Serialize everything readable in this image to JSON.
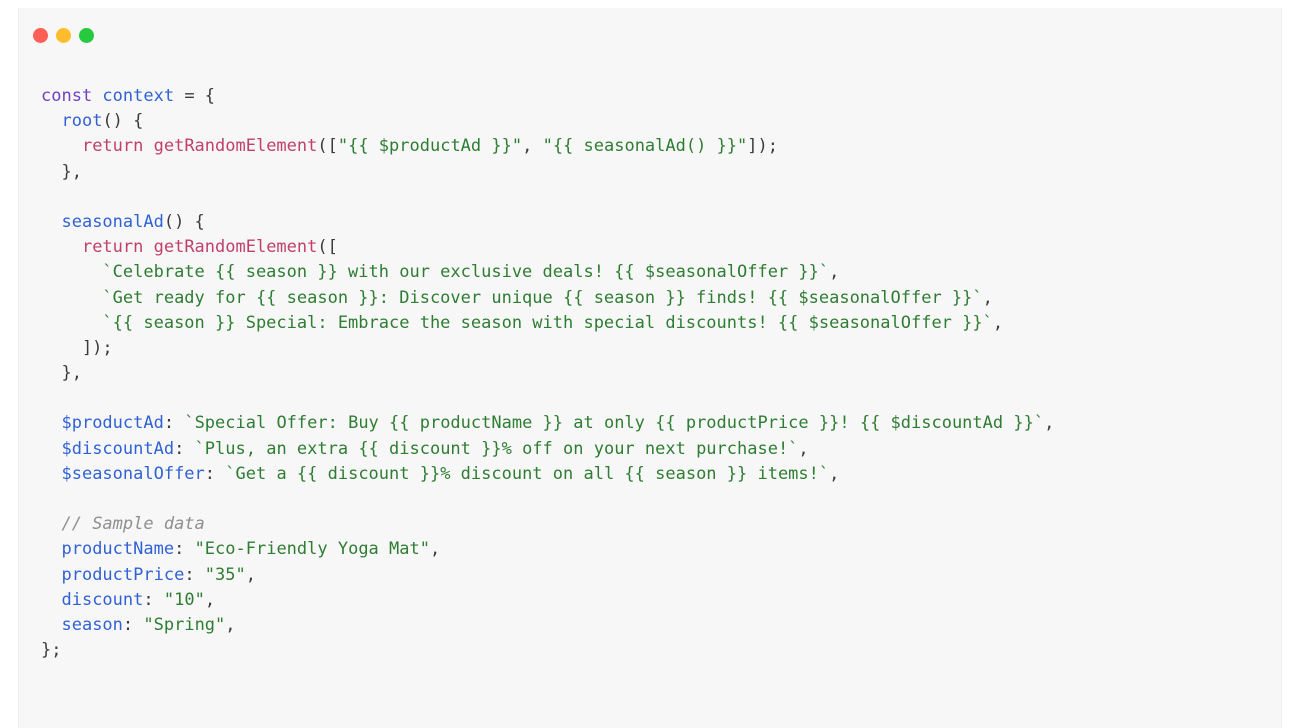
{
  "window": {
    "controls": {
      "close_color": "#ff5f56",
      "minimize_color": "#ffbd2e",
      "zoom_color": "#27c93f"
    }
  },
  "code": {
    "lines": [
      [
        {
          "t": "const ",
          "c": "kw"
        },
        {
          "t": "context",
          "c": "var"
        },
        {
          "t": " = {",
          "c": "pun"
        }
      ],
      [
        {
          "t": "  ",
          "c": "pun"
        },
        {
          "t": "root",
          "c": "prop"
        },
        {
          "t": "() {",
          "c": "pun"
        }
      ],
      [
        {
          "t": "    ",
          "c": "pun"
        },
        {
          "t": "return ",
          "c": "fn"
        },
        {
          "t": "getRandomElement",
          "c": "fn"
        },
        {
          "t": "([",
          "c": "pun"
        },
        {
          "t": "\"{{ $productAd }}\"",
          "c": "str"
        },
        {
          "t": ", ",
          "c": "pun"
        },
        {
          "t": "\"{{ seasonalAd() }}\"",
          "c": "str"
        },
        {
          "t": "]);",
          "c": "pun"
        }
      ],
      [
        {
          "t": "  },",
          "c": "pun"
        }
      ],
      [
        {
          "t": "",
          "c": "pun"
        }
      ],
      [
        {
          "t": "  ",
          "c": "pun"
        },
        {
          "t": "seasonalAd",
          "c": "prop"
        },
        {
          "t": "() {",
          "c": "pun"
        }
      ],
      [
        {
          "t": "    ",
          "c": "pun"
        },
        {
          "t": "return ",
          "c": "fn"
        },
        {
          "t": "getRandomElement",
          "c": "fn"
        },
        {
          "t": "([",
          "c": "pun"
        }
      ],
      [
        {
          "t": "      ",
          "c": "pun"
        },
        {
          "t": "`Celebrate {{ season }} with our exclusive deals! {{ $seasonalOffer }}`",
          "c": "str"
        },
        {
          "t": ",",
          "c": "pun"
        }
      ],
      [
        {
          "t": "      ",
          "c": "pun"
        },
        {
          "t": "`Get ready for {{ season }}: Discover unique {{ season }} finds! {{ $seasonalOffer }}`",
          "c": "str"
        },
        {
          "t": ",",
          "c": "pun"
        }
      ],
      [
        {
          "t": "      ",
          "c": "pun"
        },
        {
          "t": "`{{ season }} Special: Embrace the season with special discounts! {{ $seasonalOffer }}`",
          "c": "str"
        },
        {
          "t": ",",
          "c": "pun"
        }
      ],
      [
        {
          "t": "    ]);",
          "c": "pun"
        }
      ],
      [
        {
          "t": "  },",
          "c": "pun"
        }
      ],
      [
        {
          "t": "",
          "c": "pun"
        }
      ],
      [
        {
          "t": "  ",
          "c": "pun"
        },
        {
          "t": "$productAd",
          "c": "prop"
        },
        {
          "t": ": ",
          "c": "pun"
        },
        {
          "t": "`Special Offer: Buy {{ productName }} at only {{ productPrice }}! {{ $discountAd }}`",
          "c": "str"
        },
        {
          "t": ",",
          "c": "pun"
        }
      ],
      [
        {
          "t": "  ",
          "c": "pun"
        },
        {
          "t": "$discountAd",
          "c": "prop"
        },
        {
          "t": ": ",
          "c": "pun"
        },
        {
          "t": "`Plus, an extra {{ discount }}% off on your next purchase!`",
          "c": "str"
        },
        {
          "t": ",",
          "c": "pun"
        }
      ],
      [
        {
          "t": "  ",
          "c": "pun"
        },
        {
          "t": "$seasonalOffer",
          "c": "prop"
        },
        {
          "t": ": ",
          "c": "pun"
        },
        {
          "t": "`Get a {{ discount }}% discount on all {{ season }} items!`",
          "c": "str"
        },
        {
          "t": ",",
          "c": "pun"
        }
      ],
      [
        {
          "t": "",
          "c": "pun"
        }
      ],
      [
        {
          "t": "  ",
          "c": "pun"
        },
        {
          "t": "// Sample data",
          "c": "cmt"
        }
      ],
      [
        {
          "t": "  ",
          "c": "pun"
        },
        {
          "t": "productName",
          "c": "prop"
        },
        {
          "t": ": ",
          "c": "pun"
        },
        {
          "t": "\"Eco-Friendly Yoga Mat\"",
          "c": "str"
        },
        {
          "t": ",",
          "c": "pun"
        }
      ],
      [
        {
          "t": "  ",
          "c": "pun"
        },
        {
          "t": "productPrice",
          "c": "prop"
        },
        {
          "t": ": ",
          "c": "pun"
        },
        {
          "t": "\"35\"",
          "c": "str"
        },
        {
          "t": ",",
          "c": "pun"
        }
      ],
      [
        {
          "t": "  ",
          "c": "pun"
        },
        {
          "t": "discount",
          "c": "prop"
        },
        {
          "t": ": ",
          "c": "pun"
        },
        {
          "t": "\"10\"",
          "c": "str"
        },
        {
          "t": ",",
          "c": "pun"
        }
      ],
      [
        {
          "t": "  ",
          "c": "pun"
        },
        {
          "t": "season",
          "c": "prop"
        },
        {
          "t": ": ",
          "c": "pun"
        },
        {
          "t": "\"Spring\"",
          "c": "str"
        },
        {
          "t": ",",
          "c": "pun"
        }
      ],
      [
        {
          "t": "};",
          "c": "pun"
        }
      ]
    ]
  }
}
